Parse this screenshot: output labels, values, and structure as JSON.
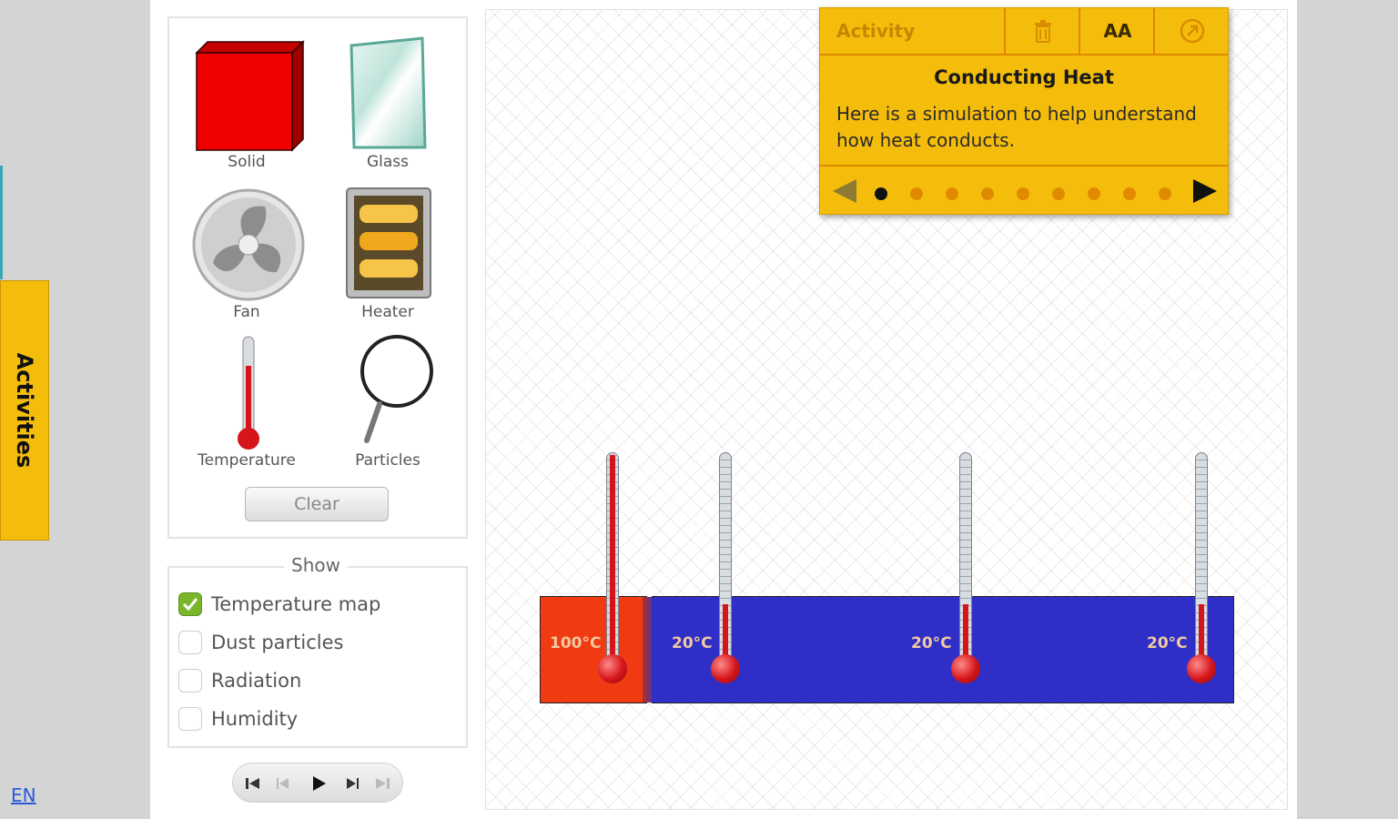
{
  "sidebar": {
    "activities_tab": "Activities",
    "language": "EN"
  },
  "tools": {
    "solid": "Solid",
    "glass": "Glass",
    "fan": "Fan",
    "heater": "Heater",
    "temperature": "Temperature",
    "particles": "Particles",
    "clear_button": "Clear"
  },
  "show": {
    "title": "Show",
    "options": [
      {
        "label": "Temperature map",
        "checked": true
      },
      {
        "label": "Dust particles",
        "checked": false
      },
      {
        "label": "Radiation",
        "checked": false
      },
      {
        "label": "Humidity",
        "checked": false
      }
    ]
  },
  "playback": {
    "icons": [
      "skip-to-start-icon",
      "step-back-icon",
      "play-icon",
      "step-forward-icon",
      "skip-to-end-icon"
    ]
  },
  "simulation": {
    "readings": [
      "100°C",
      "20°C",
      "20°C",
      "20°C"
    ],
    "hot_color": "#f03a12",
    "cold_color": "#2f2fc7"
  },
  "activity": {
    "tab_label": "Activity",
    "heading": "Conducting Heat",
    "text": "Here is a simulation to help understand how heat conducts.",
    "font_button": "AA",
    "current_step": 1,
    "total_steps": 9,
    "accent": "#f5bd0b"
  }
}
